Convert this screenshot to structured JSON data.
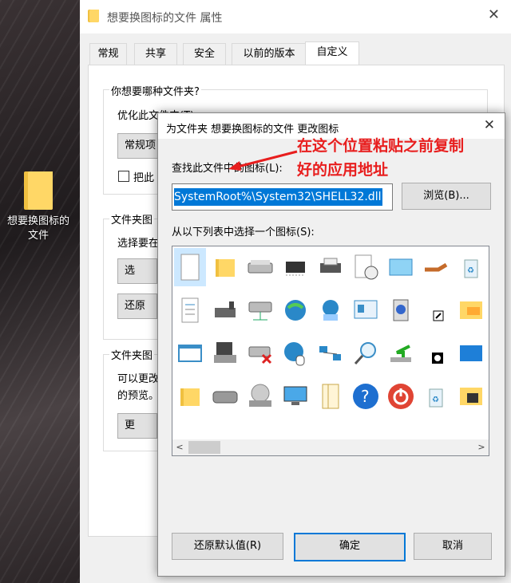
{
  "desktop": {
    "icon_label": "想要换图标的\n文件"
  },
  "properties": {
    "title": "想要换图标的文件 属性",
    "close": "✕",
    "tabs": [
      "常规",
      "共享",
      "安全",
      "以前的版本",
      "自定义"
    ],
    "active_tab": "自定义",
    "group1_title": "你想要哪种文件夹?",
    "optimize_label": "优化此文件夹(T):",
    "optimize_value": "常规项",
    "apply_check_label": "把此",
    "group2_title": "文件夹图",
    "choose_text": "选择要在",
    "choose_button": "选",
    "restore_button": "还原",
    "group3_title": "文件夹图",
    "change_text_1": "可以更改",
    "change_text_2": "的预览。",
    "change_button": "更"
  },
  "dialog": {
    "title": "为文件夹 想要换图标的文件 更改图标",
    "close": "✕",
    "find_label": "查找此文件中的图标(L):",
    "path_value": "SystemRoot%\\System32\\SHELL32.dll",
    "browse_button": "浏览(B)...",
    "list_label": "从以下列表中选择一个图标(S):",
    "restore_default_button": "还原默认值(R)",
    "ok_button": "确定",
    "cancel_button": "取消",
    "icons": [
      "blank-document-icon",
      "folder-icon",
      "drive-icon",
      "chip-icon",
      "printer-icon",
      "clock-document-icon",
      "window-icon",
      "hand-icon",
      "recycle-bin-full-icon",
      "text-document-icon",
      "network-printer-icon",
      "network-drive-icon",
      "globe-icon",
      "globe-network-icon",
      "presentation-icon",
      "cd-icon",
      "shortcut-arrow-icon",
      "network-folder-icon",
      "app-window-icon",
      "floppy-icon",
      "disconnected-drive-icon",
      "globe-cursor-icon",
      "network-icon",
      "magnifier-icon",
      "download-icon",
      "clock-icon",
      "blue-window-icon",
      "folder-icon-2",
      "hard-drive-icon",
      "cd-drive-icon",
      "monitor-icon",
      "document-icon",
      "help-icon",
      "power-icon",
      "recycle-bin-icon",
      "network-folder-icon-2"
    ]
  },
  "annotation": {
    "line1": "在这个位置粘贴之前复制",
    "line2": "好的应用地址"
  },
  "colors": {
    "selection": "#0078d7",
    "annotation": "#e81e1e",
    "folder": "#ffd766"
  }
}
